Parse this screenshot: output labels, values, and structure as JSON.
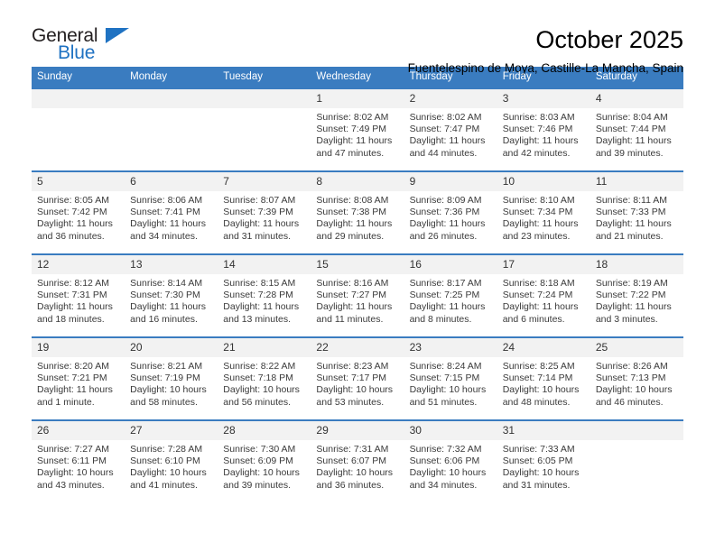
{
  "logo": {
    "word_one": "General",
    "word_two": "Blue",
    "triangle_icon": "triangle-icon",
    "brand_color": "#1f72c2"
  },
  "header": {
    "title": "October 2025",
    "subtitle": "Fuentelespino de Moya, Castille-La Mancha, Spain"
  },
  "calendar": {
    "header_color": "#3a7cc0",
    "daynum_band_color": "#f2f2f2",
    "weekday_headers": [
      "Sunday",
      "Monday",
      "Tuesday",
      "Wednesday",
      "Thursday",
      "Friday",
      "Saturday"
    ],
    "weeks": [
      [
        {
          "day": "",
          "empty": true
        },
        {
          "day": "",
          "empty": true
        },
        {
          "day": "",
          "empty": true
        },
        {
          "day": "1",
          "sunrise": "Sunrise: 8:02 AM",
          "sunset": "Sunset: 7:49 PM",
          "daylight_line1": "Daylight: 11 hours",
          "daylight_line2": "and 47 minutes."
        },
        {
          "day": "2",
          "sunrise": "Sunrise: 8:02 AM",
          "sunset": "Sunset: 7:47 PM",
          "daylight_line1": "Daylight: 11 hours",
          "daylight_line2": "and 44 minutes."
        },
        {
          "day": "3",
          "sunrise": "Sunrise: 8:03 AM",
          "sunset": "Sunset: 7:46 PM",
          "daylight_line1": "Daylight: 11 hours",
          "daylight_line2": "and 42 minutes."
        },
        {
          "day": "4",
          "sunrise": "Sunrise: 8:04 AM",
          "sunset": "Sunset: 7:44 PM",
          "daylight_line1": "Daylight: 11 hours",
          "daylight_line2": "and 39 minutes."
        }
      ],
      [
        {
          "day": "5",
          "sunrise": "Sunrise: 8:05 AM",
          "sunset": "Sunset: 7:42 PM",
          "daylight_line1": "Daylight: 11 hours",
          "daylight_line2": "and 36 minutes."
        },
        {
          "day": "6",
          "sunrise": "Sunrise: 8:06 AM",
          "sunset": "Sunset: 7:41 PM",
          "daylight_line1": "Daylight: 11 hours",
          "daylight_line2": "and 34 minutes."
        },
        {
          "day": "7",
          "sunrise": "Sunrise: 8:07 AM",
          "sunset": "Sunset: 7:39 PM",
          "daylight_line1": "Daylight: 11 hours",
          "daylight_line2": "and 31 minutes."
        },
        {
          "day": "8",
          "sunrise": "Sunrise: 8:08 AM",
          "sunset": "Sunset: 7:38 PM",
          "daylight_line1": "Daylight: 11 hours",
          "daylight_line2": "and 29 minutes."
        },
        {
          "day": "9",
          "sunrise": "Sunrise: 8:09 AM",
          "sunset": "Sunset: 7:36 PM",
          "daylight_line1": "Daylight: 11 hours",
          "daylight_line2": "and 26 minutes."
        },
        {
          "day": "10",
          "sunrise": "Sunrise: 8:10 AM",
          "sunset": "Sunset: 7:34 PM",
          "daylight_line1": "Daylight: 11 hours",
          "daylight_line2": "and 23 minutes."
        },
        {
          "day": "11",
          "sunrise": "Sunrise: 8:11 AM",
          "sunset": "Sunset: 7:33 PM",
          "daylight_line1": "Daylight: 11 hours",
          "daylight_line2": "and 21 minutes."
        }
      ],
      [
        {
          "day": "12",
          "sunrise": "Sunrise: 8:12 AM",
          "sunset": "Sunset: 7:31 PM",
          "daylight_line1": "Daylight: 11 hours",
          "daylight_line2": "and 18 minutes."
        },
        {
          "day": "13",
          "sunrise": "Sunrise: 8:14 AM",
          "sunset": "Sunset: 7:30 PM",
          "daylight_line1": "Daylight: 11 hours",
          "daylight_line2": "and 16 minutes."
        },
        {
          "day": "14",
          "sunrise": "Sunrise: 8:15 AM",
          "sunset": "Sunset: 7:28 PM",
          "daylight_line1": "Daylight: 11 hours",
          "daylight_line2": "and 13 minutes."
        },
        {
          "day": "15",
          "sunrise": "Sunrise: 8:16 AM",
          "sunset": "Sunset: 7:27 PM",
          "daylight_line1": "Daylight: 11 hours",
          "daylight_line2": "and 11 minutes."
        },
        {
          "day": "16",
          "sunrise": "Sunrise: 8:17 AM",
          "sunset": "Sunset: 7:25 PM",
          "daylight_line1": "Daylight: 11 hours",
          "daylight_line2": "and 8 minutes."
        },
        {
          "day": "17",
          "sunrise": "Sunrise: 8:18 AM",
          "sunset": "Sunset: 7:24 PM",
          "daylight_line1": "Daylight: 11 hours",
          "daylight_line2": "and 6 minutes."
        },
        {
          "day": "18",
          "sunrise": "Sunrise: 8:19 AM",
          "sunset": "Sunset: 7:22 PM",
          "daylight_line1": "Daylight: 11 hours",
          "daylight_line2": "and 3 minutes."
        }
      ],
      [
        {
          "day": "19",
          "sunrise": "Sunrise: 8:20 AM",
          "sunset": "Sunset: 7:21 PM",
          "daylight_line1": "Daylight: 11 hours",
          "daylight_line2": "and 1 minute."
        },
        {
          "day": "20",
          "sunrise": "Sunrise: 8:21 AM",
          "sunset": "Sunset: 7:19 PM",
          "daylight_line1": "Daylight: 10 hours",
          "daylight_line2": "and 58 minutes."
        },
        {
          "day": "21",
          "sunrise": "Sunrise: 8:22 AM",
          "sunset": "Sunset: 7:18 PM",
          "daylight_line1": "Daylight: 10 hours",
          "daylight_line2": "and 56 minutes."
        },
        {
          "day": "22",
          "sunrise": "Sunrise: 8:23 AM",
          "sunset": "Sunset: 7:17 PM",
          "daylight_line1": "Daylight: 10 hours",
          "daylight_line2": "and 53 minutes."
        },
        {
          "day": "23",
          "sunrise": "Sunrise: 8:24 AM",
          "sunset": "Sunset: 7:15 PM",
          "daylight_line1": "Daylight: 10 hours",
          "daylight_line2": "and 51 minutes."
        },
        {
          "day": "24",
          "sunrise": "Sunrise: 8:25 AM",
          "sunset": "Sunset: 7:14 PM",
          "daylight_line1": "Daylight: 10 hours",
          "daylight_line2": "and 48 minutes."
        },
        {
          "day": "25",
          "sunrise": "Sunrise: 8:26 AM",
          "sunset": "Sunset: 7:13 PM",
          "daylight_line1": "Daylight: 10 hours",
          "daylight_line2": "and 46 minutes."
        }
      ],
      [
        {
          "day": "26",
          "sunrise": "Sunrise: 7:27 AM",
          "sunset": "Sunset: 6:11 PM",
          "daylight_line1": "Daylight: 10 hours",
          "daylight_line2": "and 43 minutes."
        },
        {
          "day": "27",
          "sunrise": "Sunrise: 7:28 AM",
          "sunset": "Sunset: 6:10 PM",
          "daylight_line1": "Daylight: 10 hours",
          "daylight_line2": "and 41 minutes."
        },
        {
          "day": "28",
          "sunrise": "Sunrise: 7:30 AM",
          "sunset": "Sunset: 6:09 PM",
          "daylight_line1": "Daylight: 10 hours",
          "daylight_line2": "and 39 minutes."
        },
        {
          "day": "29",
          "sunrise": "Sunrise: 7:31 AM",
          "sunset": "Sunset: 6:07 PM",
          "daylight_line1": "Daylight: 10 hours",
          "daylight_line2": "and 36 minutes."
        },
        {
          "day": "30",
          "sunrise": "Sunrise: 7:32 AM",
          "sunset": "Sunset: 6:06 PM",
          "daylight_line1": "Daylight: 10 hours",
          "daylight_line2": "and 34 minutes."
        },
        {
          "day": "31",
          "sunrise": "Sunrise: 7:33 AM",
          "sunset": "Sunset: 6:05 PM",
          "daylight_line1": "Daylight: 10 hours",
          "daylight_line2": "and 31 minutes."
        },
        {
          "day": "",
          "empty": true
        }
      ]
    ]
  }
}
